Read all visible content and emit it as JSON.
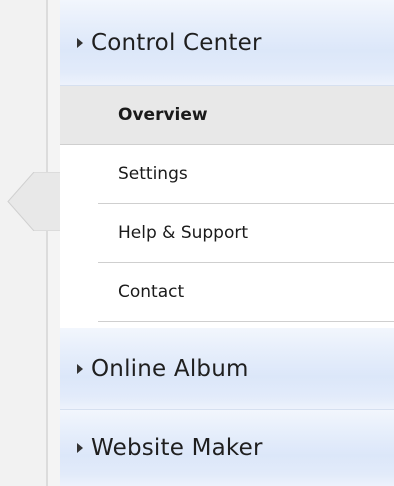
{
  "sections": [
    {
      "label": "Control Center",
      "expanded": true
    },
    {
      "label": "Online Album",
      "expanded": false
    },
    {
      "label": "Website Maker",
      "expanded": false
    }
  ],
  "submenu": {
    "items": [
      {
        "label": "Overview",
        "active": true
      },
      {
        "label": "Settings",
        "active": false
      },
      {
        "label": "Help & Support",
        "active": false
      },
      {
        "label": "Contact",
        "active": false
      }
    ]
  },
  "icons": {
    "section_arrow": "triangle-right-icon",
    "active_pointer": "active-pointer-icon"
  },
  "colors": {
    "header_gradient_top": "#f2f6fd",
    "header_gradient_mid": "#dce7f9",
    "active_item_bg": "#e8e8e8",
    "divider": "#cfcfcf"
  }
}
